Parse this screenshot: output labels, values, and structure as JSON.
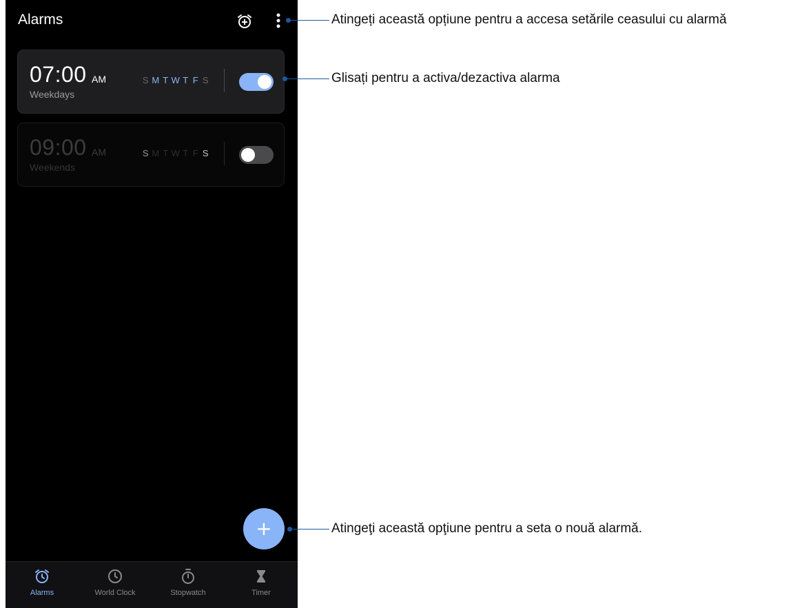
{
  "header": {
    "title": "Alarms"
  },
  "alarms": [
    {
      "time": "07:00",
      "ampm": "AM",
      "label": "Weekdays",
      "days": [
        "S",
        "M",
        "T",
        "W",
        "T",
        "F",
        "S"
      ],
      "active_days": [
        false,
        true,
        true,
        true,
        true,
        true,
        false
      ],
      "enabled": true
    },
    {
      "time": "09:00",
      "ampm": "AM",
      "label": "Weekends",
      "days": [
        "S",
        "M",
        "T",
        "W",
        "T",
        "F",
        "S"
      ],
      "active_days": [
        true,
        false,
        false,
        false,
        false,
        false,
        true
      ],
      "enabled": false
    }
  ],
  "fab": {
    "symbol": "+"
  },
  "nav": {
    "items": [
      {
        "label": "Alarms",
        "icon": "alarm-icon",
        "active": true
      },
      {
        "label": "World Clock",
        "icon": "clock-icon",
        "active": false
      },
      {
        "label": "Stopwatch",
        "icon": "stopwatch-icon",
        "active": false
      },
      {
        "label": "Timer",
        "icon": "hourglass-icon",
        "active": false
      }
    ]
  },
  "callouts": {
    "settings": "Atingeți această opțiune pentru a accesa setările ceasului cu alarmă",
    "toggle": "Glisați pentru a activa/dezactiva alarma",
    "add": "Atingeţi această opţiune pentru a seta o nouă alarmă."
  },
  "colors": {
    "accent": "#8ab4f8",
    "background": "#000000",
    "callout_line": "#1a5aa0",
    "inactive_text": "#8a8a8a"
  }
}
